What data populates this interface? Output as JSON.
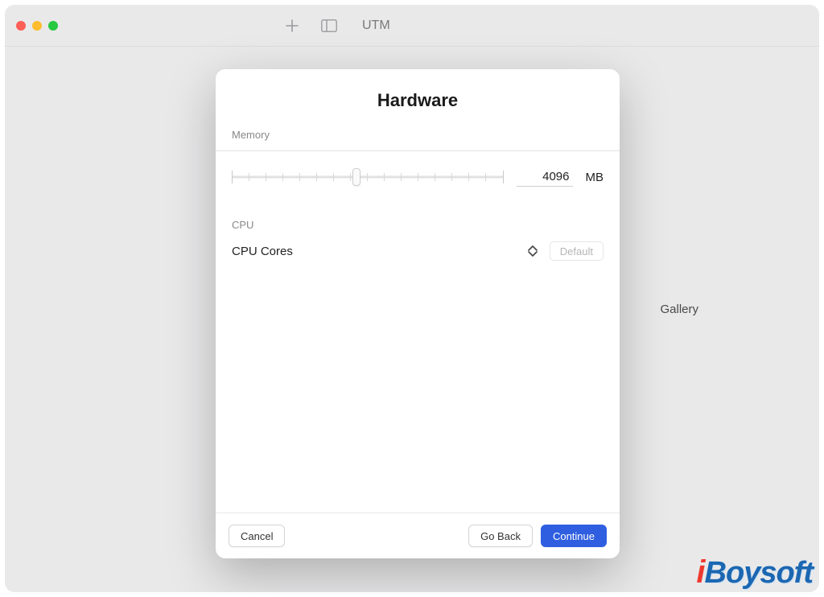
{
  "app": {
    "title": "UTM"
  },
  "background": {
    "gallery_label": "Gallery"
  },
  "modal": {
    "title": "Hardware",
    "memory": {
      "section_label": "Memory",
      "value": "4096",
      "unit": "MB"
    },
    "cpu": {
      "section_label": "CPU",
      "cores_label": "CPU Cores",
      "default_button": "Default"
    },
    "footer": {
      "cancel": "Cancel",
      "go_back": "Go Back",
      "continue": "Continue"
    }
  },
  "watermark": {
    "prefix": "i",
    "rest": "Boysoft"
  }
}
